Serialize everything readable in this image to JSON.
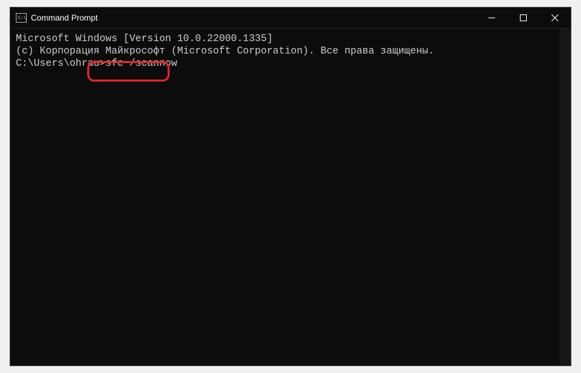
{
  "window": {
    "title": "Command Prompt"
  },
  "terminal": {
    "line1": "Microsoft Windows [Version 10.0.22000.1335]",
    "line2": "(c) Корпорация Майкрософт (Microsoft Corporation). Все права защищены.",
    "blank": "",
    "prompt": "C:\\Users\\ohrau>",
    "command": "sfc /scannow"
  },
  "buttons": {
    "minimize": "minimize",
    "maximize": "maximize",
    "close": "close"
  }
}
